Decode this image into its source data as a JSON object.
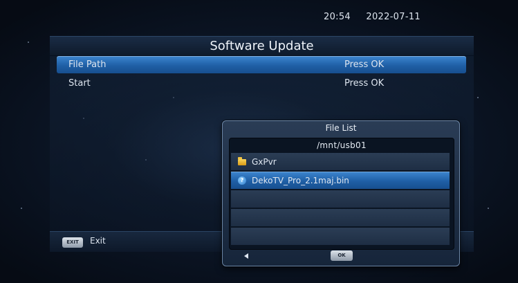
{
  "status_bar": {
    "time": "20:54",
    "date": "2022-07-11"
  },
  "window": {
    "title": "Software Update"
  },
  "menu": {
    "items": [
      {
        "label": "File Path",
        "value": "Press OK",
        "selected": true
      },
      {
        "label": "Start",
        "value": "Press OK",
        "selected": false
      }
    ]
  },
  "footer": {
    "exit_key_label": "EXIT",
    "exit_label": "Exit"
  },
  "file_list": {
    "title": "File List",
    "path": "/mnt/usb01",
    "entries": [
      {
        "name": "GxPvr",
        "icon": "folder-icon",
        "selected": false
      },
      {
        "name": "DekoTV_Pro_2.1maj.bin",
        "icon": "unknown-file-icon",
        "selected": true
      }
    ],
    "empty_rows": 3,
    "ok_key_label": "OK"
  },
  "colors": {
    "selection": "#2a6db8",
    "panel": "#142438",
    "folder": "#f2c442"
  }
}
